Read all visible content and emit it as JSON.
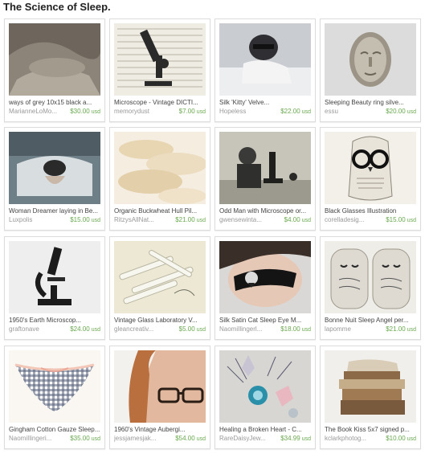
{
  "page": {
    "title": "The Science of Sleep."
  },
  "colors": {
    "price": "#6aa84f",
    "seller": "#9a9a9a",
    "title": "#444444",
    "border": "#dcdcdc"
  },
  "items": [
    {
      "title": "ways of grey 10x15 black a...",
      "seller": "MarianneLoMo...",
      "price": "$30.00",
      "currency": "usd",
      "thumb": "grey-sheets-photo"
    },
    {
      "title": "Microscope - Vintage DICTI...",
      "seller": "memorydust",
      "price": "$7.00",
      "currency": "usd",
      "thumb": "microscope-dictionary-print"
    },
    {
      "title": "Silk 'Kitty' Velve...",
      "seller": "Hopeless",
      "price": "$22.00",
      "currency": "usd",
      "thumb": "woman-with-sleep-mask-photo"
    },
    {
      "title": "Sleeping Beauty ring silve...",
      "seller": "essu",
      "price": "$20.00",
      "currency": "usd",
      "thumb": "silver-face-ring"
    },
    {
      "title": "Woman Dreamer laying in Be...",
      "seller": "Luxpolis",
      "price": "$15.00",
      "currency": "usd",
      "thumb": "woman-lying-in-bed-photo"
    },
    {
      "title": "Organic Buckwheat Hull Pil...",
      "seller": "RitzysAllNat...",
      "price": "$21.00",
      "currency": "usd",
      "thumb": "buckwheat-pillows"
    },
    {
      "title": "Odd Man with Microscope or...",
      "seller": "gwensewinta...",
      "price": "$4.00",
      "currency": "usd",
      "thumb": "man-with-microscope-photo"
    },
    {
      "title": "Black Glasses Illustration",
      "seller": "corelladesig...",
      "price": "$15.00",
      "currency": "usd",
      "thumb": "owl-glasses-illustration"
    },
    {
      "title": "1950's Earth Microscop...",
      "seller": "graftonave",
      "price": "$24.00",
      "currency": "usd",
      "thumb": "black-microscope"
    },
    {
      "title": "Vintage Glass Laboratory V...",
      "seller": "gleancreativ...",
      "price": "$5.00",
      "currency": "usd",
      "thumb": "glass-lab-vials"
    },
    {
      "title": "Silk Satin Cat Sleep Eye M...",
      "seller": "NaomiIlingerl...",
      "price": "$18.00",
      "currency": "usd",
      "thumb": "satin-eye-mask-photo"
    },
    {
      "title": "Bonne Nuit Sleep Angel per...",
      "seller": "lapomme",
      "price": "$21.00",
      "currency": "usd",
      "thumb": "bonne-nuit-pillows"
    },
    {
      "title": "Gingham Cotton Gauze Sleep...",
      "seller": "NaomiIlingeri...",
      "price": "$35.00",
      "currency": "usd",
      "thumb": "gingham-lingerie"
    },
    {
      "title": "1960's Vintage Aubergi...",
      "seller": "jessjamesjak...",
      "price": "$54.00",
      "currency": "usd",
      "thumb": "vintage-eyeglasses-photo"
    },
    {
      "title": "Healing a Broken Heart - C...",
      "seller": "RareDaisyJew...",
      "price": "$34.99",
      "currency": "usd",
      "thumb": "crystals-and-lavender"
    },
    {
      "title": "The Book Kiss 5x7 signed p...",
      "seller": "kclarkphotog...",
      "price": "$10.00",
      "currency": "usd",
      "thumb": "stacked-books-photo"
    }
  ]
}
